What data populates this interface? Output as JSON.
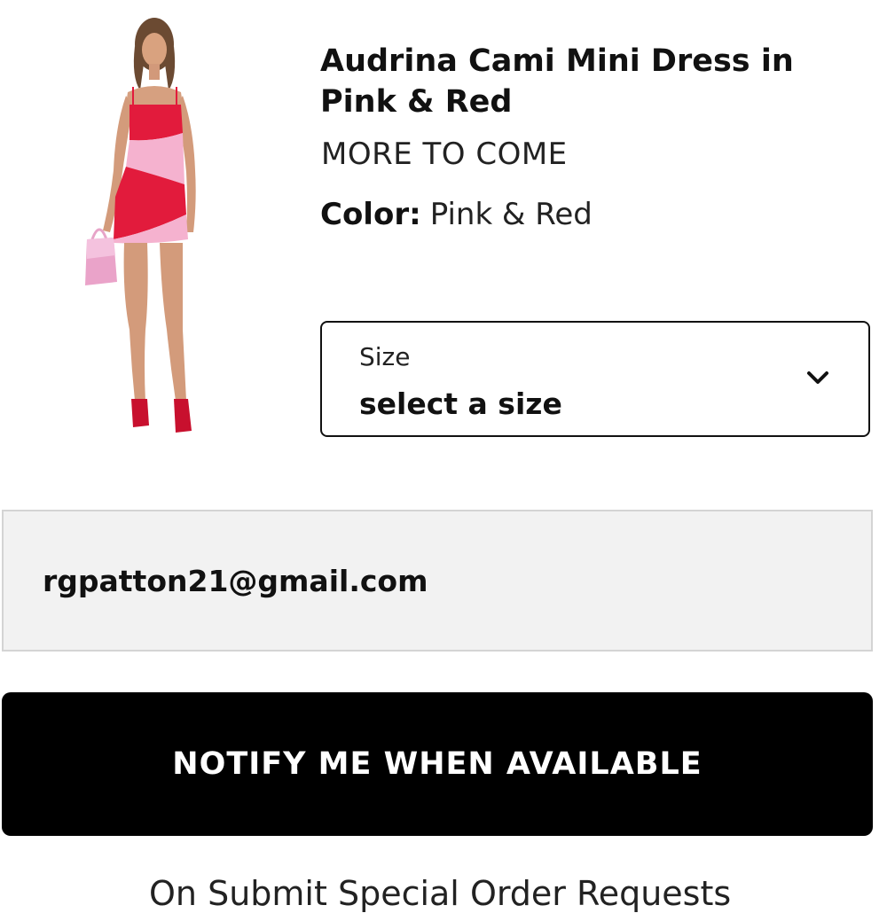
{
  "product": {
    "title": "Audrina Cami Mini Dress in Pink & Red",
    "stock_status": "MORE TO COME",
    "color_label": "Color:",
    "color_value": "Pink & Red",
    "image_icon": "product-photo"
  },
  "size_select": {
    "label": "Size",
    "value": "select a size",
    "icon": "chevron-down-icon"
  },
  "email_input": {
    "value": "rgpatton21@gmail.com"
  },
  "notify_button": {
    "label": "NOTIFY ME WHEN AVAILABLE"
  },
  "footer_note": {
    "text": "On Submit Special Order Requests"
  },
  "colors": {
    "button_bg": "#000000",
    "button_text": "#ffffff",
    "input_bg": "#f2f2f2",
    "dress_red": "#e21b3c",
    "dress_pink": "#f5b2cf"
  }
}
